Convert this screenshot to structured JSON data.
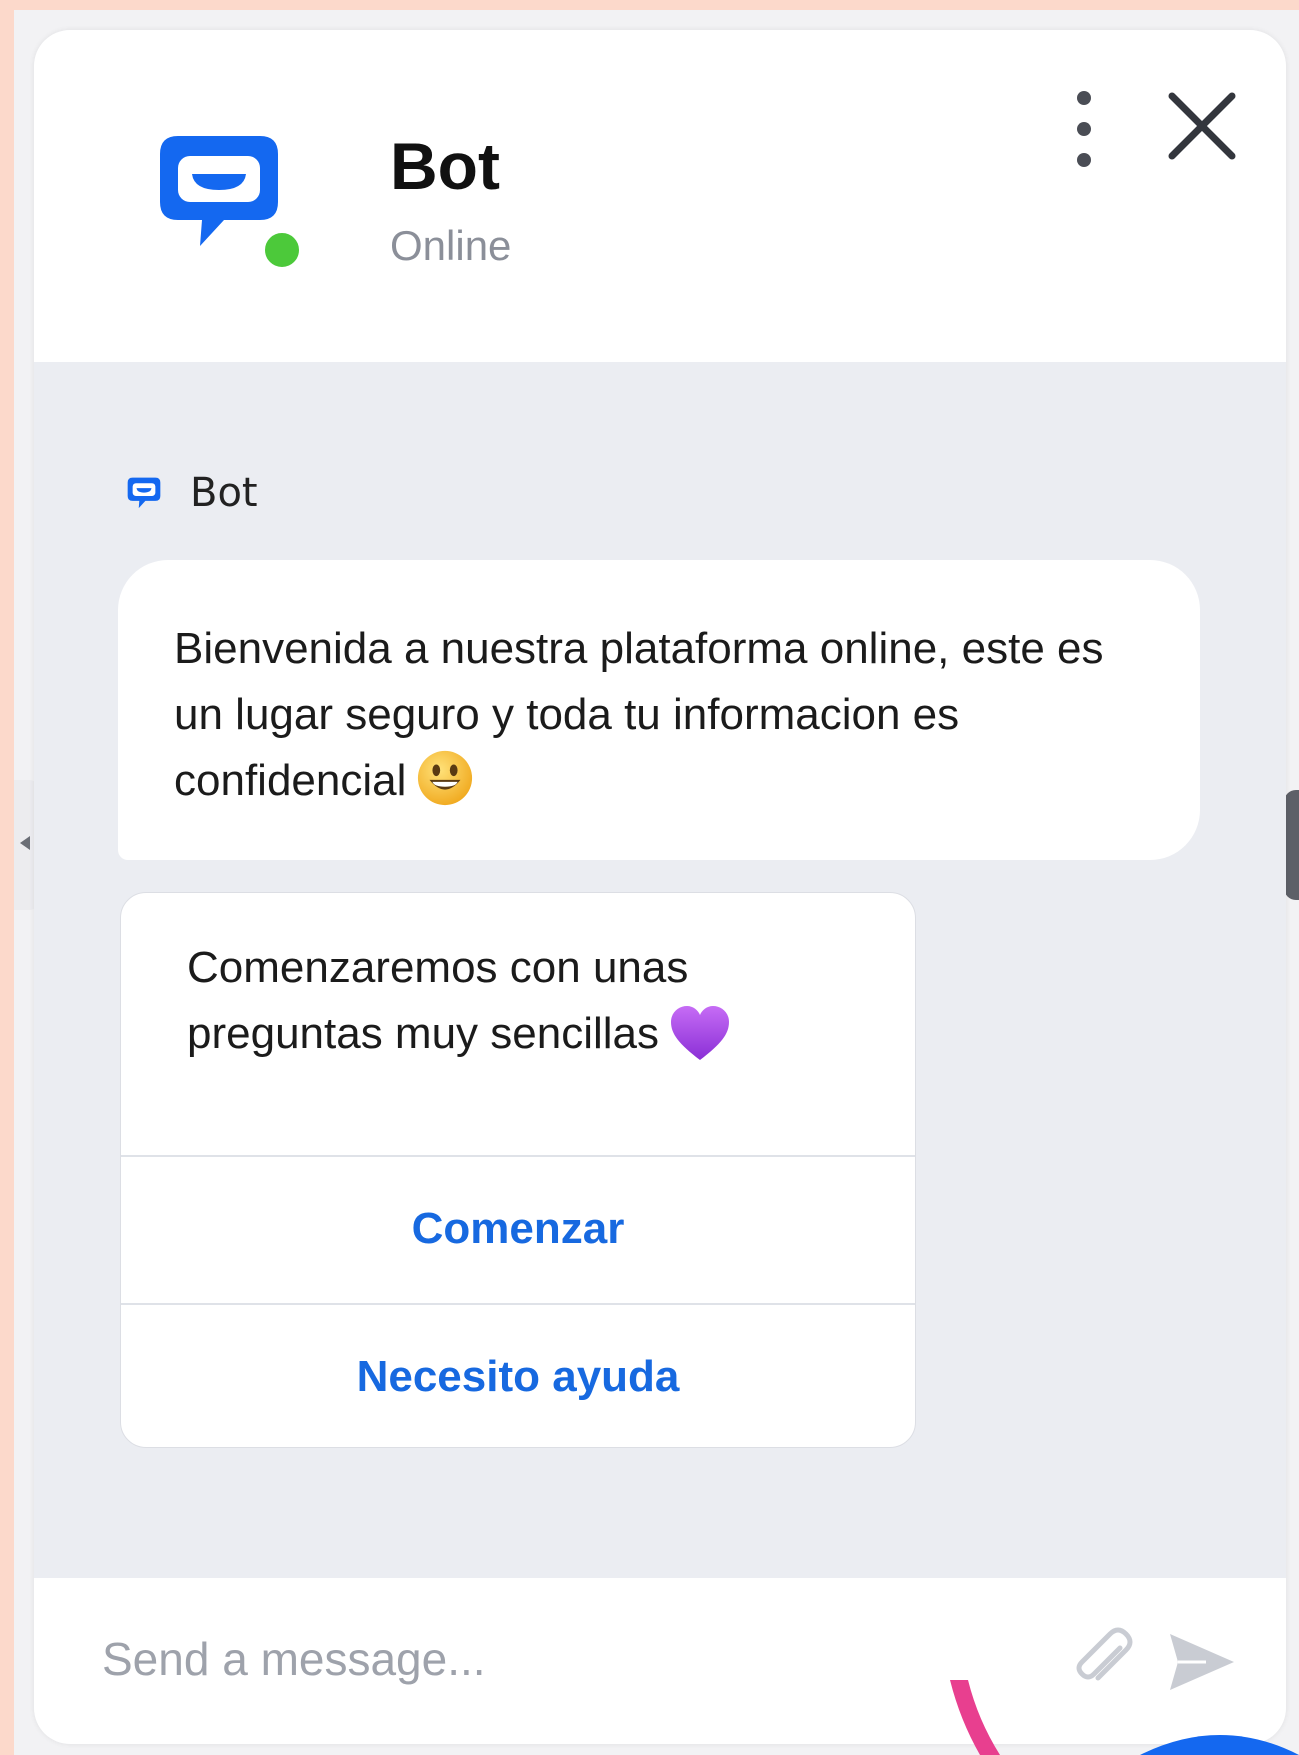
{
  "header": {
    "bot_name": "Bot",
    "status": "Online"
  },
  "conversation": {
    "sender_name": "Bot",
    "welcome_message": "Bienvenida a nuestra plataforma online, este es un lugar seguro y toda tu informacion es confidencial",
    "welcome_emoji": "smiling-face-emoji",
    "card": {
      "text": "Comenzaremos con unas preguntas muy sencillas",
      "emoji": "purple-heart-emoji",
      "buttons": [
        "Comenzar",
        "Necesito ayuda"
      ]
    }
  },
  "composer": {
    "placeholder": "Send a message..."
  },
  "icons": [
    "chat-logo-icon",
    "more-options-icon",
    "close-icon",
    "attachment-icon",
    "send-icon"
  ],
  "colors": {
    "accent": "#1769e0",
    "logo_blue": "#1468f0",
    "online_green": "#4cc93a",
    "page_background": "#fcd9cb",
    "chat_background": "#ebedf2"
  }
}
